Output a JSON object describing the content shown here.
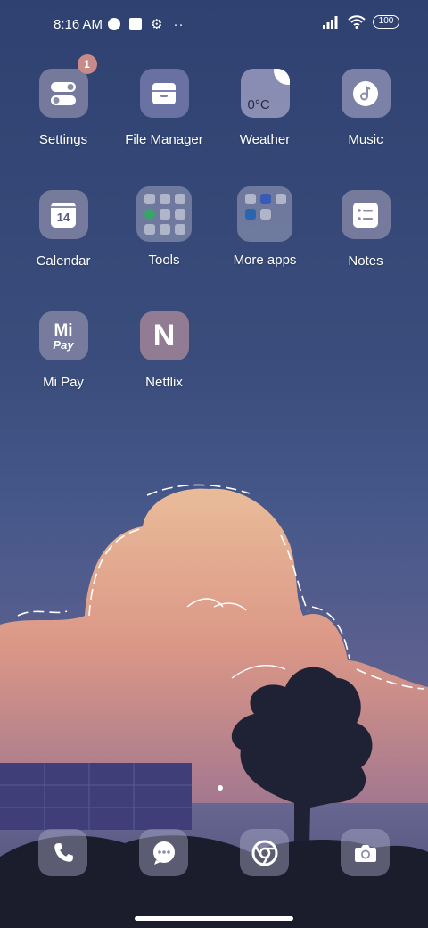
{
  "status_bar": {
    "time": "8:16 AM",
    "battery": "100"
  },
  "apps": [
    {
      "label": "Settings",
      "icon": "settings-toggle-icon",
      "badge": "1"
    },
    {
      "label": "File Manager",
      "icon": "file-manager-icon"
    },
    {
      "label": "Weather",
      "icon": "weather-icon",
      "icon_text": "0°C"
    },
    {
      "label": "Music",
      "icon": "music-icon"
    },
    {
      "label": "Calendar",
      "icon": "calendar-icon",
      "icon_text": "14"
    },
    {
      "label": "Tools",
      "icon": "folder-icon"
    },
    {
      "label": "More apps",
      "icon": "folder-icon"
    },
    {
      "label": "Notes",
      "icon": "notes-icon"
    },
    {
      "label": "Mi Pay",
      "icon": "mi-pay-icon",
      "icon_text_top": "Mi",
      "icon_text_bottom": "Pay"
    },
    {
      "label": "Netflix",
      "icon": "netflix-icon",
      "icon_text": "N"
    }
  ],
  "dock": [
    {
      "name": "phone",
      "icon": "phone-icon"
    },
    {
      "name": "messages",
      "icon": "message-icon"
    },
    {
      "name": "chrome",
      "icon": "chrome-icon"
    },
    {
      "name": "camera",
      "icon": "camera-icon"
    }
  ],
  "colors": {
    "sky_top": "#2f4170",
    "cloud": "#e8a08a",
    "icon_bg": "#8c8caa",
    "badge": "#c98a8a"
  }
}
